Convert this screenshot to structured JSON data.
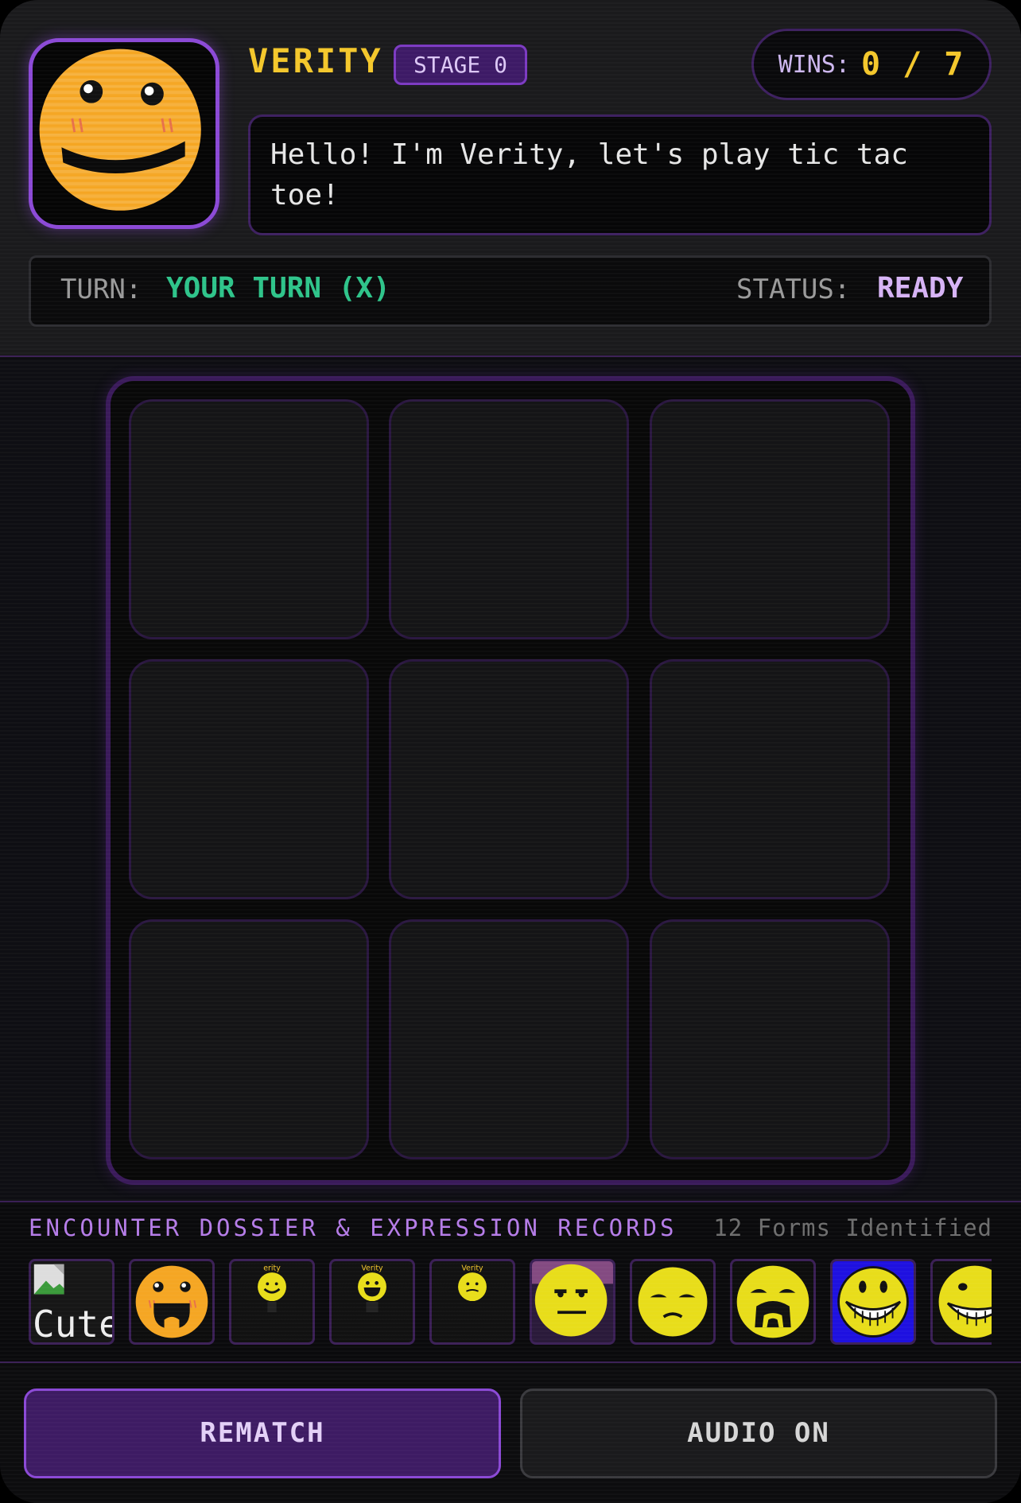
{
  "header": {
    "name": "VERITY",
    "stage": "STAGE 0",
    "wins_label": "WINS:",
    "wins_value": "0 / 7",
    "speech": "Hello! I'm Verity, let's play tic tac toe!",
    "turn_label": "TURN:",
    "turn_value": "YOUR TURN (X)",
    "status_label": "STATUS:",
    "status_value": "READY"
  },
  "board": {
    "cells": [
      "",
      "",
      "",
      "",
      "",
      "",
      "",
      "",
      ""
    ]
  },
  "dossier": {
    "title": "ENCOUNTER DOSSIER & EXPRESSION RECORDS",
    "count": "12 Forms Identified",
    "thumbs": [
      {
        "icon": "broken-image-icon",
        "label": "Cute"
      },
      {
        "icon": "happy-open-mouth-face-icon"
      },
      {
        "icon": "small-smiley-icon",
        "label": "erity"
      },
      {
        "icon": "small-smiley-icon",
        "label": "Verity"
      },
      {
        "icon": "small-confused-face-icon",
        "label": "Verity"
      },
      {
        "icon": "neutral-face-icon"
      },
      {
        "icon": "frowning-face-icon"
      },
      {
        "icon": "screaming-face-icon"
      },
      {
        "icon": "grinning-teeth-face-icon"
      },
      {
        "icon": "creepy-grin-face-icon"
      }
    ]
  },
  "footer": {
    "rematch_label": "REMATCH",
    "audio_label": "AUDIO ON"
  },
  "colors": {
    "accent_purple": "#8b49d6",
    "name_yellow": "#f4c72b",
    "turn_green": "#2ec48a",
    "status_lilac": "#d6b3f5",
    "face_orange": "#f5a623",
    "face_yellow": "#e8dd1a"
  }
}
